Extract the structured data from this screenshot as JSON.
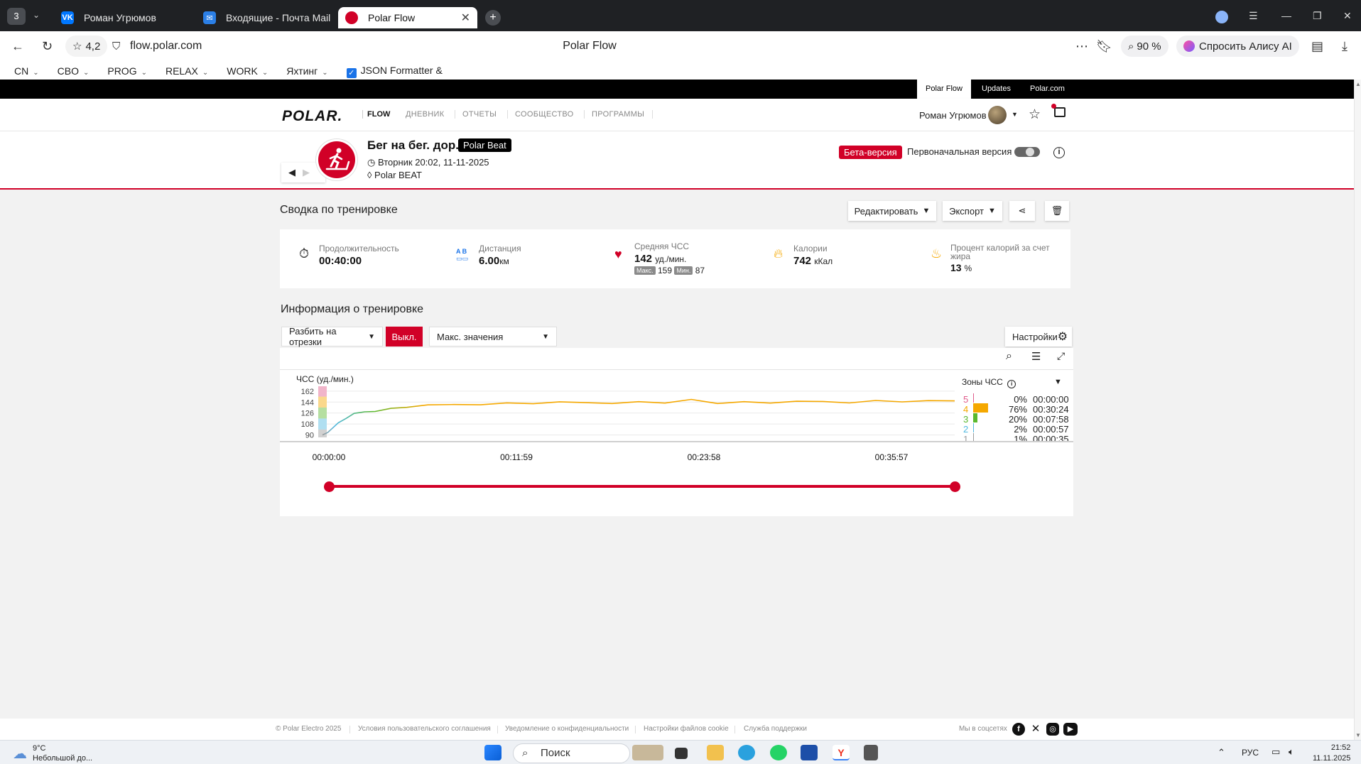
{
  "browser": {
    "tab_counter": "3",
    "tabs": [
      {
        "label": "Роман Угрюмов",
        "icon": "vk-icon"
      },
      {
        "label": "Входящие - Почта Mail",
        "icon": "mail-icon"
      },
      {
        "label": "Polar Flow",
        "icon": "polar-icon"
      }
    ],
    "rating": "4,2",
    "url": "flow.polar.com",
    "page_title": "Polar Flow",
    "zoom": "90 %",
    "alice_label": "Спросить Алису AI"
  },
  "bookmarks": [
    {
      "label": "CN"
    },
    {
      "label": "CBO"
    },
    {
      "label": "PROG"
    },
    {
      "label": "RELAX"
    },
    {
      "label": "WORK"
    },
    {
      "label": "Яхтинг"
    },
    {
      "label": "JSON Formatter &"
    }
  ],
  "polar_topbar": [
    "Polar Flow",
    "Updates",
    "Polar.com"
  ],
  "polar_nav": {
    "logo": "POLAR.",
    "flow": "FLOW",
    "links": [
      "ДНЕВНИК",
      "ОТЧЕТЫ",
      "СООБЩЕСТВО",
      "ПРОГРАММЫ"
    ],
    "user": "Роман Угрюмов"
  },
  "training": {
    "title": "Бег на бег. дор.",
    "device_badge": "Polar Beat",
    "date": "Вторник 20:02, 11-11-2025",
    "device": "Polar BEAT",
    "beta": "Бета-версия",
    "original_version": "Первоначальная версия"
  },
  "summary": {
    "title": "Сводка по тренировке",
    "edit_btn": "Редактировать",
    "export_btn": "Экспорт",
    "stats": {
      "duration": {
        "label": "Продолжительность",
        "value": "00:40:00"
      },
      "distance": {
        "label": "Дистанция",
        "value": "6.00",
        "unit": "км"
      },
      "hr": {
        "label": "Средняя ЧСС",
        "value": "142",
        "unit": "уд./мин.",
        "max_label": "Макс.",
        "max": "159",
        "min_label": "Мин.",
        "min": "87"
      },
      "calories": {
        "label": "Калории",
        "value": "742",
        "unit": "кКал"
      },
      "fat": {
        "label1": "Процент калорий за счет",
        "label2": "жира",
        "value": "13",
        "unit": "%"
      }
    }
  },
  "info": {
    "title": "Информация о тренировке",
    "split_label": "Разбить на отрезки",
    "off_label": "Выкл.",
    "max_values": "Макс. значения",
    "settings": "Настройки",
    "chart_label": "ЧСС (уд./мин.)",
    "zones_title": "Зоны ЧСС",
    "zones": [
      {
        "n": "5",
        "pct": "0%",
        "time": "00:00:00",
        "color": "#e05a8a",
        "frac": 0.0
      },
      {
        "n": "4",
        "pct": "76%",
        "time": "00:30:24",
        "color": "#f5a800",
        "frac": 0.76
      },
      {
        "n": "3",
        "pct": "20%",
        "time": "00:07:58",
        "color": "#5ab82e",
        "frac": 0.2
      },
      {
        "n": "2",
        "pct": "2%",
        "time": "00:00:57",
        "color": "#4fb8e0",
        "frac": 0.02
      },
      {
        "n": "1",
        "pct": "1%",
        "time": "00:00:35",
        "color": "#9a9a9a",
        "frac": 0.01
      }
    ],
    "timeline": [
      "00:00:00",
      "00:11:59",
      "00:23:58",
      "00:35:57"
    ]
  },
  "chart_data": {
    "type": "line",
    "ylabel": "ЧСС (уд./мин.)",
    "yticks": [
      90,
      108,
      126,
      144,
      162
    ],
    "ylim": [
      86,
      170
    ],
    "xlim": [
      0,
      2400
    ],
    "x": [
      0,
      20,
      40,
      60,
      90,
      120,
      160,
      200,
      260,
      320,
      400,
      500,
      600,
      700,
      800,
      900,
      1000,
      1100,
      1200,
      1300,
      1400,
      1450,
      1500,
      1600,
      1700,
      1800,
      1900,
      2000,
      2100,
      2200,
      2300,
      2400
    ],
    "y": [
      90,
      94,
      102,
      110,
      118,
      124,
      128,
      130,
      133,
      136,
      138,
      140,
      141,
      142,
      142,
      143,
      143,
      143,
      144,
      143,
      147,
      145,
      143,
      144,
      143,
      144,
      145,
      144,
      146,
      145,
      145,
      146
    ],
    "zone_colors": [
      "#9a9a9a",
      "#4fb8e0",
      "#5ab82e",
      "#f5a800",
      "#e05a8a"
    ]
  },
  "footer": {
    "copyright": "© Polar Electro 2025",
    "links": [
      "Условия пользовательского соглашения",
      "Уведомление о конфиденциальности",
      "Настройки файлов cookie",
      "Служба поддержки"
    ],
    "social_label": "Мы в соцсетях"
  },
  "taskbar": {
    "weather_temp": "9°C",
    "weather_desc": "Небольшой до...",
    "search": "Поиск",
    "lang": "РУС",
    "time": "21:52",
    "date": "11.11.2025"
  }
}
